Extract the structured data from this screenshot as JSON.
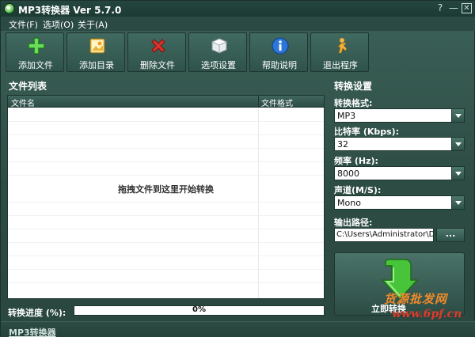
{
  "window": {
    "title": "MP3转换器 Ver 5.7.0",
    "help_button": "?",
    "minimize_button": "—",
    "close_button": "✕"
  },
  "menu": [
    {
      "label": "文件(F)"
    },
    {
      "label": "选项(O)"
    },
    {
      "label": "关于(A)"
    }
  ],
  "toolbar": [
    {
      "label": "添加文件",
      "icon": "plus-icon"
    },
    {
      "label": "添加目录",
      "icon": "folder-icon"
    },
    {
      "label": "删除文件",
      "icon": "delete-x-icon"
    },
    {
      "label": "选项设置",
      "icon": "settings-cube-icon"
    },
    {
      "label": "帮助说明",
      "icon": "info-icon"
    },
    {
      "label": "退出程序",
      "icon": "exit-runner-icon"
    }
  ],
  "file_list": {
    "section_title": "文件列表",
    "columns": [
      "文件名",
      "文件格式"
    ],
    "rows": [],
    "empty_hint": "拖拽文件到这里开始转换"
  },
  "settings": {
    "section_title": "转换设置",
    "format": {
      "label": "转换格式:",
      "value": "MP3"
    },
    "bitrate": {
      "label": "比特率 (Kbps):",
      "value": "32"
    },
    "frequency": {
      "label": "频率 (Hz):",
      "value": "8000"
    },
    "channel": {
      "label": "声道(M/S):",
      "value": "Mono"
    },
    "output": {
      "label": "输出路径:",
      "value": "C:\\Users\\Administrator\\D",
      "browse_label": "..."
    },
    "convert_label": "立即转换"
  },
  "progress": {
    "label": "转换进度 (%):",
    "value": 0,
    "text": "0%"
  },
  "statusbar": {
    "link": "MP3转换器"
  },
  "watermark": {
    "line1": "货源批发网",
    "line2": "www.6pf.cn"
  },
  "colors": {
    "window_bg": "#2f5048",
    "accent_green": "#4caf50",
    "delete_red": "#d9342b",
    "info_blue": "#2b76d6"
  }
}
